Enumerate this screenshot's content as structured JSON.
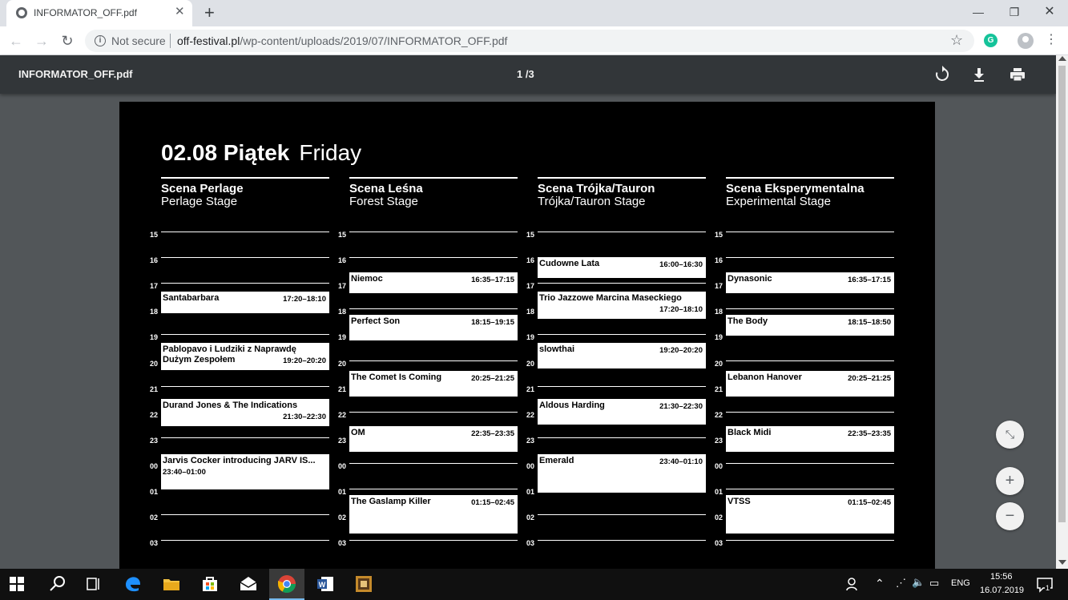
{
  "browser": {
    "tab_title": "INFORMATOR_OFF.pdf",
    "security_label": "Not secure",
    "url_domain": "off-festival.pl",
    "url_path": "/wp-content/uploads/2019/07/INFORMATOR_OFF.pdf"
  },
  "pdf_viewer": {
    "file_name": "INFORMATOR_OFF.pdf",
    "page_indicator": "1 /3"
  },
  "schedule": {
    "date": "02.08 Piątek",
    "day_en": "Friday",
    "hours": [
      "15",
      "16",
      "17",
      "18",
      "19",
      "20",
      "21",
      "22",
      "23",
      "00",
      "01",
      "02",
      "03"
    ],
    "stages": [
      {
        "name_pl": "Scena Perlage",
        "name_en": "Perlage Stage",
        "events": [
          {
            "name": "Santabarbara",
            "time": "17:20–18:10"
          },
          {
            "name": "Pablopavo i Ludziki z Naprawdę\nDużym Zespołem",
            "time": "19:20–20:20"
          },
          {
            "name": "Durand Jones & The Indications",
            "time": "21:30–22:30"
          },
          {
            "name": "Jarvis Cocker introducing JARV IS...",
            "time": "23:40–01:00"
          }
        ]
      },
      {
        "name_pl": "Scena Leśna",
        "name_en": "Forest Stage",
        "events": [
          {
            "name": "Niemoc",
            "time": "16:35–17:15"
          },
          {
            "name": "Perfect Son",
            "time": "18:15–19:15"
          },
          {
            "name": "The Comet Is Coming",
            "time": "20:25–21:25"
          },
          {
            "name": "OM",
            "time": "22:35–23:35"
          },
          {
            "name": "The Gaslamp Killer",
            "time": "01:15–02:45"
          }
        ]
      },
      {
        "name_pl": "Scena Trójka/Tauron",
        "name_en": "Trójka/Tauron Stage",
        "events": [
          {
            "name": "Cudowne Lata",
            "time": "16:00–16:30"
          },
          {
            "name": "Trio Jazzowe Marcina Maseckiego",
            "time": "17:20–18:10"
          },
          {
            "name": "slowthai",
            "time": "19:20–20:20"
          },
          {
            "name": "Aldous Harding",
            "time": "21:30–22:30"
          },
          {
            "name": "Emerald",
            "time": "23:40–01:10"
          }
        ]
      },
      {
        "name_pl": "Scena Eksperymentalna",
        "name_en": "Experimental Stage",
        "events": [
          {
            "name": "Dynasonic",
            "time": "16:35–17:15"
          },
          {
            "name": "The Body",
            "time": "18:15–18:50"
          },
          {
            "name": "Lebanon Hanover",
            "time": "20:25–21:25"
          },
          {
            "name": "Black Midi",
            "time": "22:35–23:35"
          },
          {
            "name": "VTSS",
            "time": "01:15–02:45"
          }
        ]
      }
    ]
  },
  "taskbar": {
    "language": "ENG",
    "time": "15:56",
    "date": "16.07.2019",
    "notification_count": "1"
  }
}
